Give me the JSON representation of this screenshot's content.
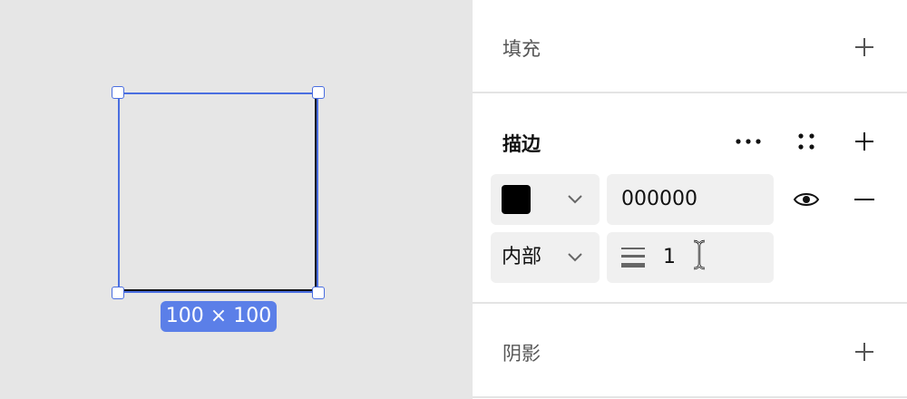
{
  "canvas": {
    "selection_size_label": "100 × 100"
  },
  "panel": {
    "fill": {
      "title": "填充",
      "add_icon": "plus-icon"
    },
    "stroke": {
      "title": "描边",
      "more_icon": "more-horizontal-icon",
      "individual_icon": "four-dots-icon",
      "add_icon": "plus-icon",
      "color_swatch": "#000000",
      "color_hex": "000000",
      "visibility_icon": "eye-icon",
      "remove_icon": "minus-icon",
      "position_value": "内部",
      "width_icon": "stroke-width-icon",
      "width_value": "1",
      "cursor_icon": "text-cursor-icon"
    },
    "shadow": {
      "title": "阴影",
      "add_icon": "plus-icon"
    }
  },
  "colors": {
    "selection": "#4a6ee0",
    "size_badge": "#5b7fe8",
    "canvas_bg": "#e6e6e6"
  }
}
